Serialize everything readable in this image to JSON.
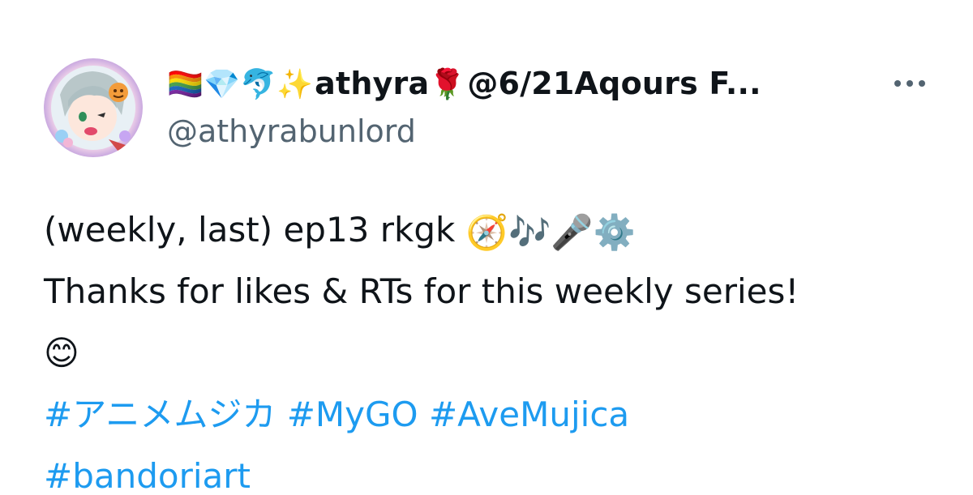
{
  "tweet": {
    "author": {
      "display_name_prefix_emojis": "🏳️‍🌈💎🐬✨",
      "display_name_main": "athyra",
      "display_name_rose": "🌹",
      "display_name_suffix": "@6/21Aqours F...",
      "handle": "@athyrabunlord",
      "avatar_icon": "avatar-anime-girl"
    },
    "more_button_icon": "ellipsis-icon",
    "text": {
      "line1_text": "(weekly, last) ep13 rkgk ",
      "line1_emojis": "🧭🎶🎤⚙️",
      "line2_text": "Thanks for likes & RTs for this weekly series!",
      "line3_emoji": "😊",
      "hashtags": [
        "#アニメムジカ",
        "#MyGO",
        "#AveMujica",
        "#bandoriart"
      ]
    },
    "colors": {
      "text": "#0f1419",
      "secondary": "#536471",
      "link": "#1d9bf0"
    }
  }
}
